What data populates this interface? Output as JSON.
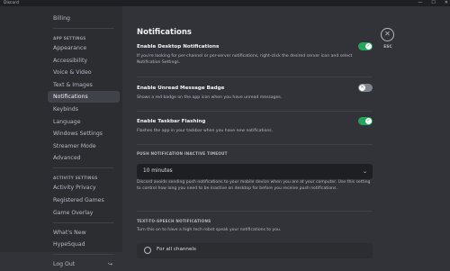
{
  "window": {
    "title": "Discord",
    "minimize": "—",
    "maximize": "☐",
    "close": "✕"
  },
  "sidebar": {
    "top_item": "Billing",
    "app_settings_title": "APP SETTINGS",
    "app_items": [
      "Appearance",
      "Accessibility",
      "Voice & Video",
      "Text & Images",
      "Notifications",
      "Keybinds",
      "Language",
      "Windows Settings",
      "Streamer Mode",
      "Advanced"
    ],
    "activity_title": "ACTIVITY SETTINGS",
    "activity_items": [
      "Activity Privacy",
      "Registered Games",
      "Game Overlay"
    ],
    "misc_items": [
      "What's New",
      "HypeSquad"
    ],
    "logout": "Log Out"
  },
  "page": {
    "title": "Notifications",
    "desktop": {
      "label": "Enable Desktop Notifications",
      "desc": "If you're looking for per-channel or per-server notifications, right-click the desired server icon and select Notification Settings.",
      "on": true
    },
    "unread": {
      "label": "Enable Unread Message Badge",
      "desc": "Shows a red badge on the app icon when you have unread messages.",
      "on": false
    },
    "taskbar": {
      "label": "Enable Taskbar Flashing",
      "desc": "Flashes the app in your taskbar when you have new notifications.",
      "on": true
    },
    "push": {
      "title": "PUSH NOTIFICATION INACTIVE TIMEOUT",
      "value": "10 minutes",
      "desc": "Discord avoids sending push notifications to your mobile device when you are at your computer. Use this setting to control how long you need to be inactive on desktop for before you receive push notifications."
    },
    "tts": {
      "title": "TEXT-TO-SPEECH NOTIFICATIONS",
      "desc": "Turn this on to have a high tech robot speak your notifications to you.",
      "option": "For all channels"
    }
  },
  "esc": {
    "label": "ESC",
    "glyph": "✕"
  },
  "colors": {
    "toggle_on": "#23a55a",
    "toggle_off": "#80848e",
    "background": "#313338",
    "sidebar": "#2b2d31"
  }
}
